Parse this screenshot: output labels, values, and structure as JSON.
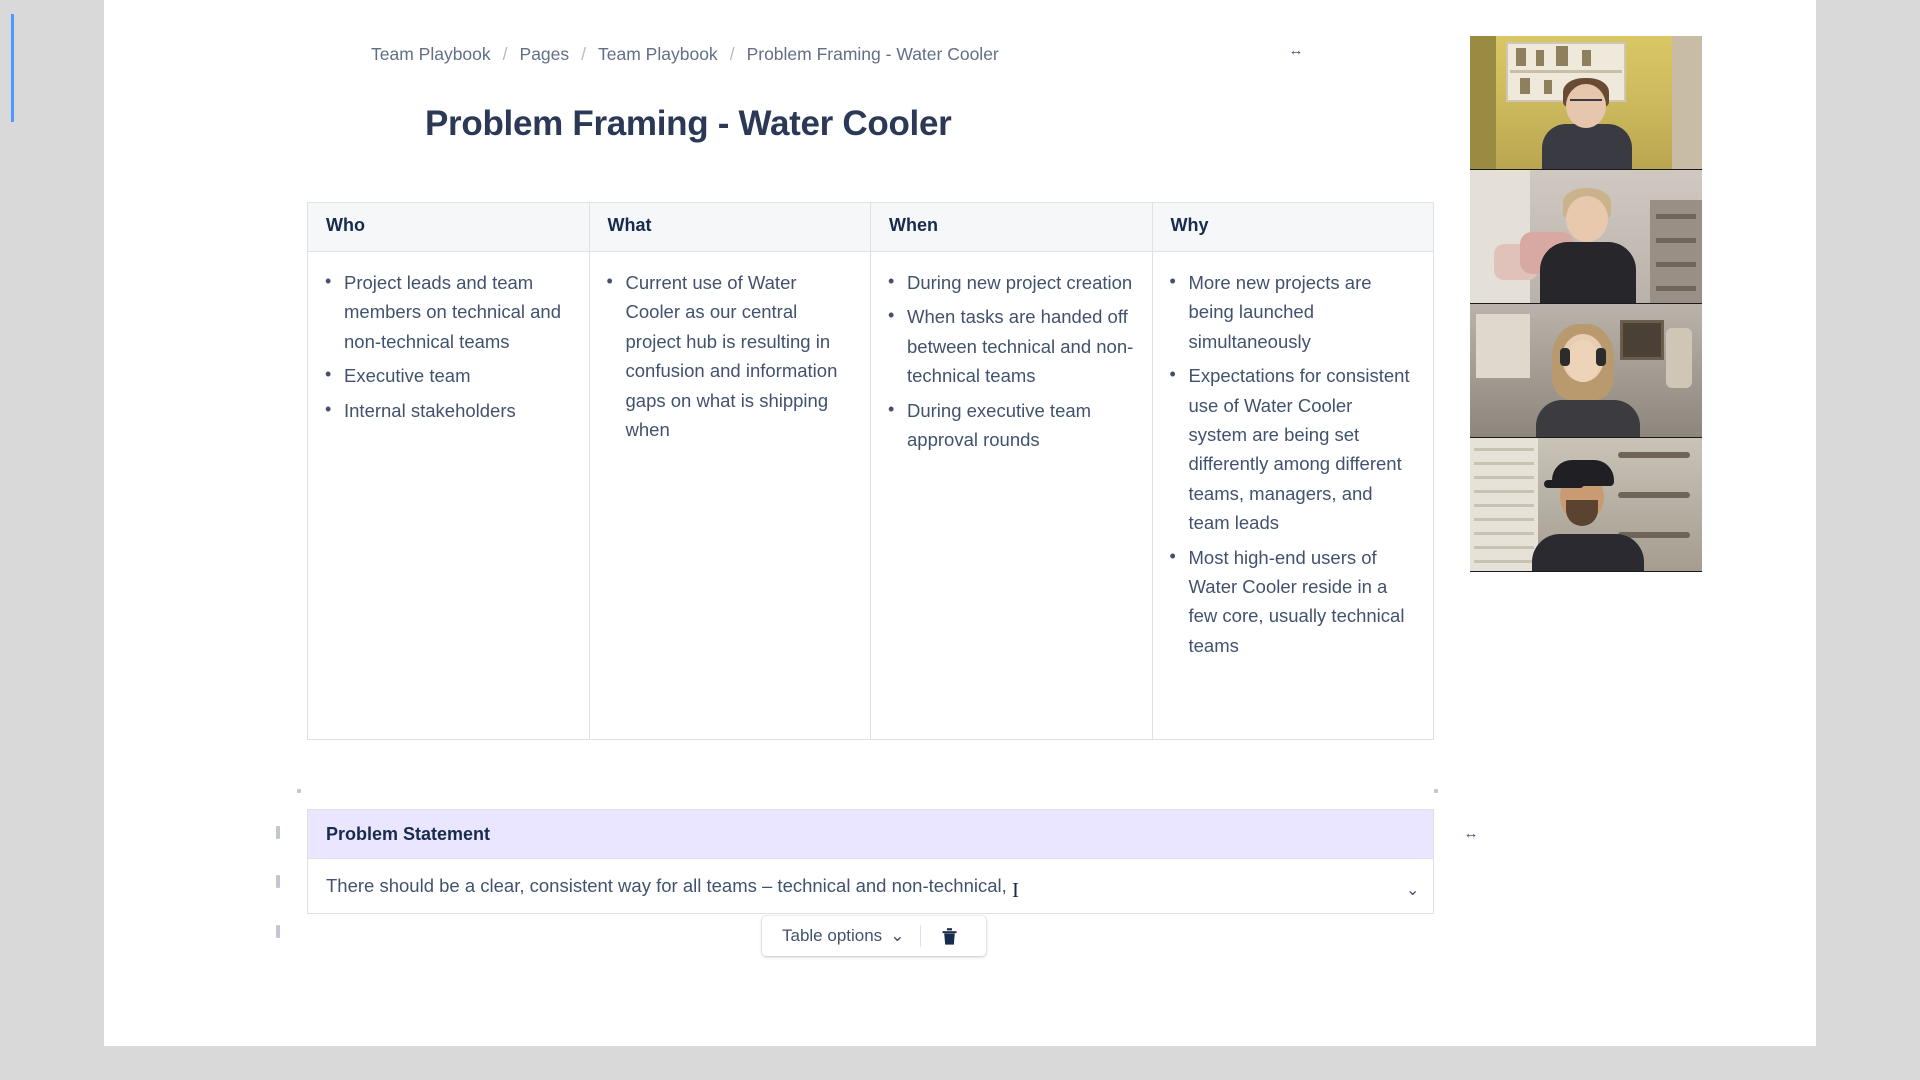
{
  "breadcrumb": {
    "items": [
      "Team Playbook",
      "Pages",
      "Team Playbook",
      "Problem Framing - Water Cooler"
    ],
    "separator": "/",
    "resize_icon": "↔"
  },
  "document": {
    "title": "Problem Framing - Water Cooler"
  },
  "main_table": {
    "headers": [
      "Who",
      "What",
      "When",
      "Why"
    ],
    "columns": [
      [
        "Project leads and team members on technical and non-technical teams",
        "Executive team",
        "Internal stakeholders"
      ],
      [
        "Current use of Water Cooler as our central project hub is resulting in confusion and information gaps on what is shipping when"
      ],
      [
        "During new project creation",
        "When tasks are handed off between technical and non-technical teams",
        "During executive team approval rounds"
      ],
      [
        "More new projects are being launched simultaneously",
        "Expectations for consistent use of Water Cooler system are being set differently among different teams, managers, and team leads",
        "Most high-end users of Water Cooler reside in a few core, usually technical teams"
      ]
    ]
  },
  "problem_statement_table": {
    "header": "Problem Statement",
    "body_text": "There should be a clear, consistent way for all teams – technical and non-technical,",
    "cell_chevron_icon": "⌄",
    "resize_icon": "↔"
  },
  "table_toolbar": {
    "options_label": "Table options",
    "options_chevron_icon": "⌄",
    "delete_icon": "trash-icon"
  },
  "video_call": {
    "participants": [
      {
        "name": "participant-1"
      },
      {
        "name": "participant-2"
      },
      {
        "name": "participant-3"
      },
      {
        "name": "participant-4"
      }
    ]
  },
  "colors": {
    "header_bg": "#f6f7f9",
    "ps_header_bg": "#eae6ff",
    "text": "#42526e",
    "heading": "#172b4d",
    "title": "#2b3856",
    "breadcrumb": "#626f86",
    "border": "#dfe1e6",
    "accent": "#4c9aff"
  }
}
